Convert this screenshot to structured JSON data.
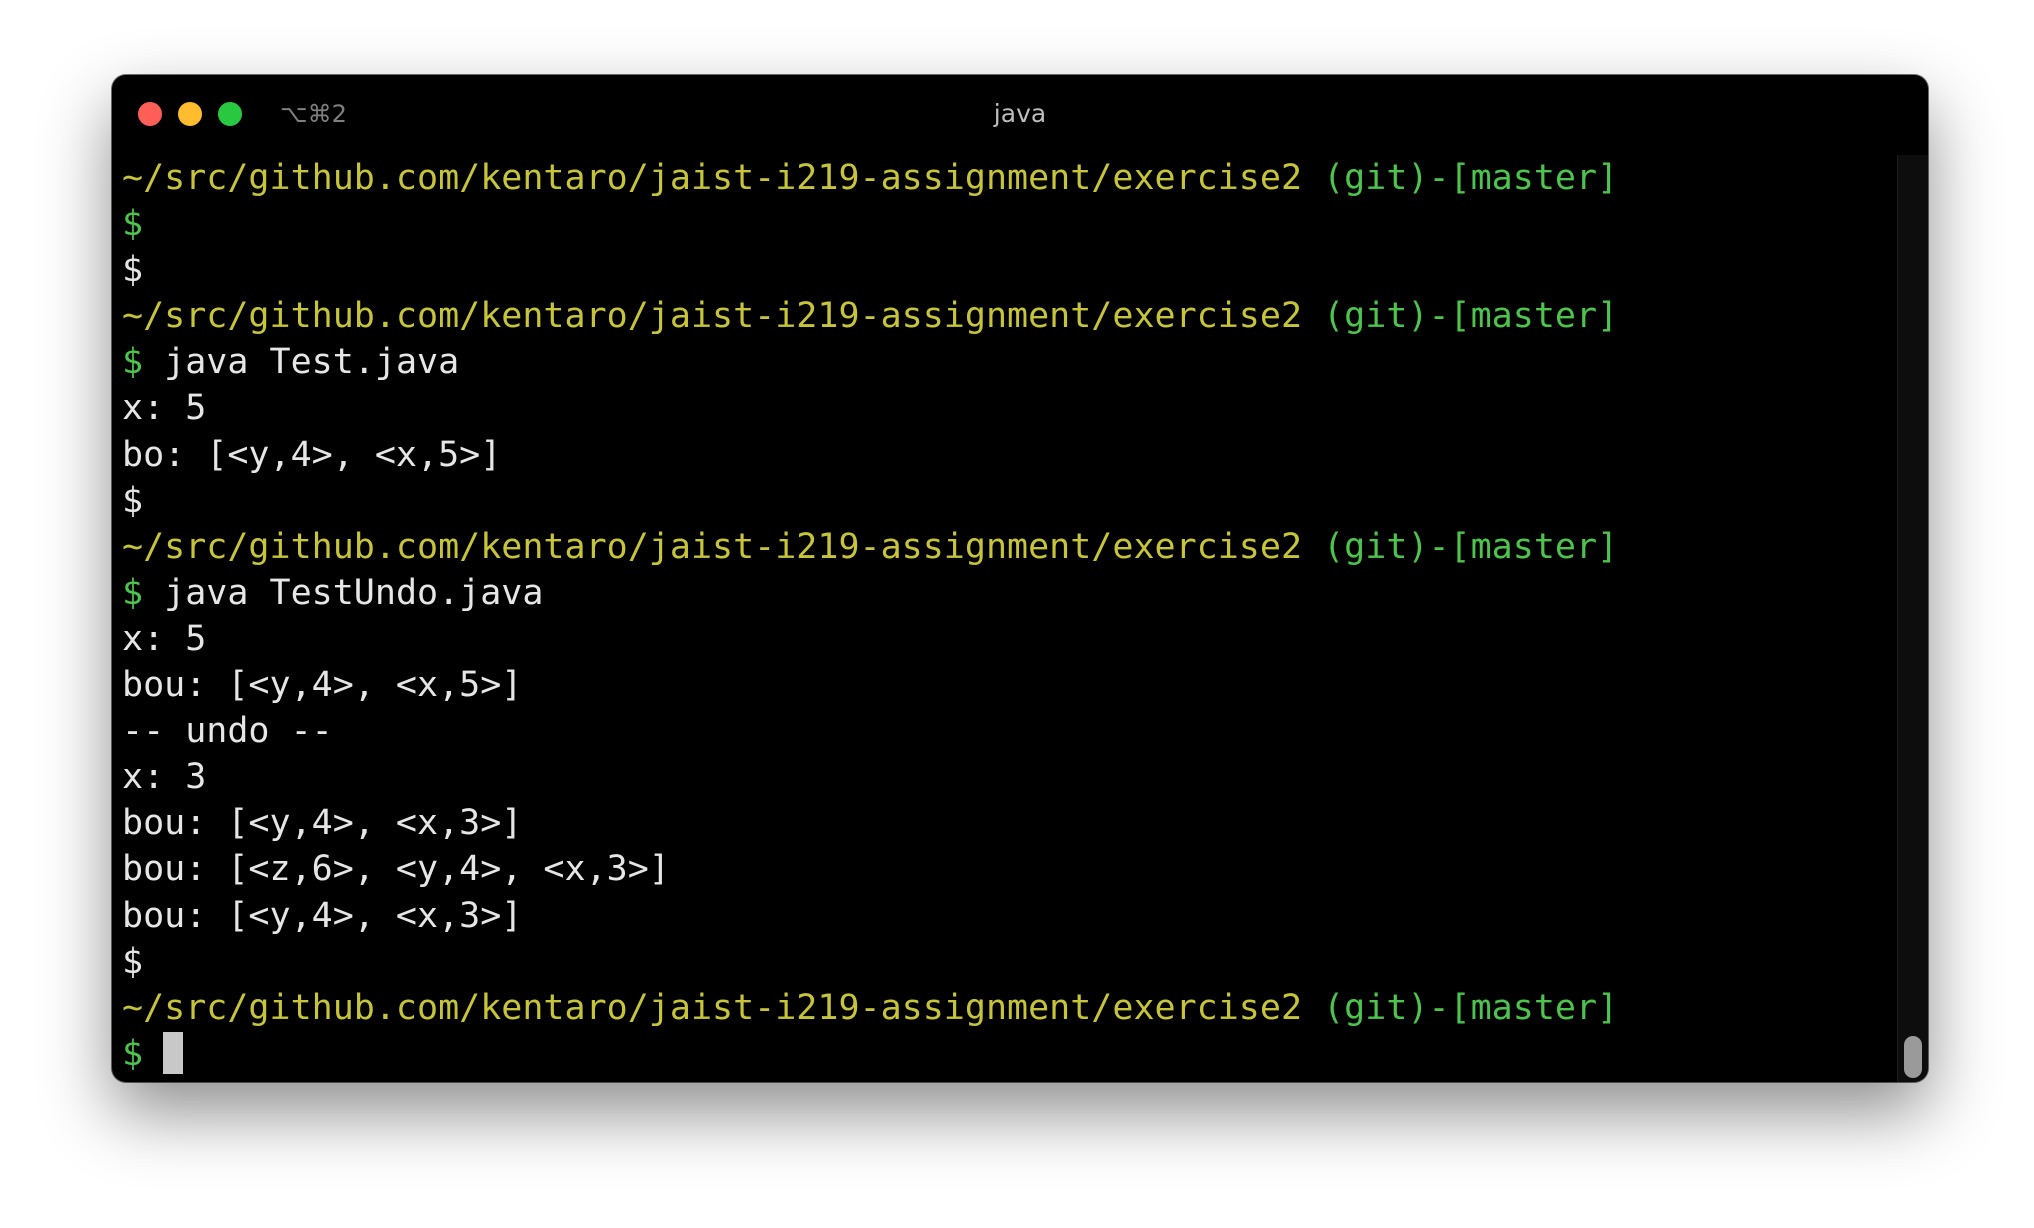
{
  "window": {
    "title": "java",
    "shortcut": "⌥⌘2"
  },
  "terminal": {
    "prompt_path": "~/src/github.com/kentaro/jaist-i219-assignment/exercise2",
    "prompt_git": " (git)-[master]",
    "prompt_symbol": "$",
    "lines": [
      {
        "type": "prompt"
      },
      {
        "type": "dollar_green",
        "text": ""
      },
      {
        "type": "dollar_plain",
        "text": ""
      },
      {
        "type": "prompt"
      },
      {
        "type": "command",
        "text": " java Test.java"
      },
      {
        "type": "output",
        "text": "x: 5"
      },
      {
        "type": "output",
        "text": "bo: [<y,4>, <x,5>]"
      },
      {
        "type": "dollar_plain",
        "text": ""
      },
      {
        "type": "prompt"
      },
      {
        "type": "command",
        "text": " java TestUndo.java"
      },
      {
        "type": "output",
        "text": "x: 5"
      },
      {
        "type": "output",
        "text": "bou: [<y,4>, <x,5>]"
      },
      {
        "type": "output",
        "text": "-- undo --"
      },
      {
        "type": "output",
        "text": "x: 3"
      },
      {
        "type": "output",
        "text": "bou: [<y,4>, <x,3>]"
      },
      {
        "type": "output",
        "text": "bou: [<z,6>, <y,4>, <x,3>]"
      },
      {
        "type": "output",
        "text": "bou: [<y,4>, <x,3>]"
      },
      {
        "type": "dollar_plain",
        "text": ""
      },
      {
        "type": "prompt"
      },
      {
        "type": "cursor"
      }
    ]
  },
  "colors": {
    "background": "#000000",
    "path": "#c6c43a",
    "git": "#4ec34d",
    "text": "#e6e6e6"
  }
}
